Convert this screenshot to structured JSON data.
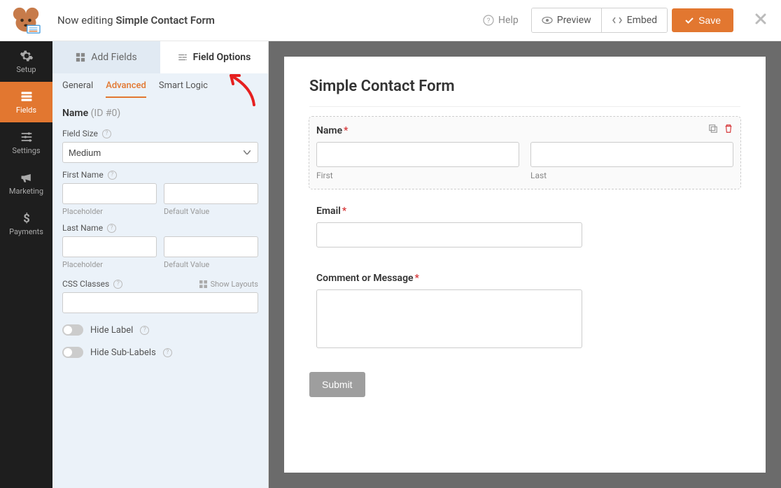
{
  "header": {
    "now_editing": "Now editing",
    "form_name": "Simple Contact Form",
    "help": "Help",
    "preview": "Preview",
    "embed": "Embed",
    "save": "Save"
  },
  "nav": {
    "setup": "Setup",
    "fields": "Fields",
    "settings": "Settings",
    "marketing": "Marketing",
    "payments": "Payments"
  },
  "panel_tabs": {
    "add_fields": "Add Fields",
    "field_options": "Field Options"
  },
  "subtabs": {
    "general": "General",
    "advanced": "Advanced",
    "smart_logic": "Smart Logic"
  },
  "options": {
    "heading_name": "Name",
    "heading_id": "(ID #0)",
    "field_size_label": "Field Size",
    "field_size_value": "Medium",
    "first_name_label": "First Name",
    "last_name_label": "Last Name",
    "placeholder_label": "Placeholder",
    "default_value_label": "Default Value",
    "css_classes_label": "CSS Classes",
    "show_layouts": "Show Layouts",
    "hide_label": "Hide Label",
    "hide_sublabels": "Hide Sub-Labels"
  },
  "preview": {
    "title": "Simple Contact Form",
    "name_label": "Name",
    "first": "First",
    "last": "Last",
    "email_label": "Email",
    "comment_label": "Comment or Message",
    "submit": "Submit"
  }
}
